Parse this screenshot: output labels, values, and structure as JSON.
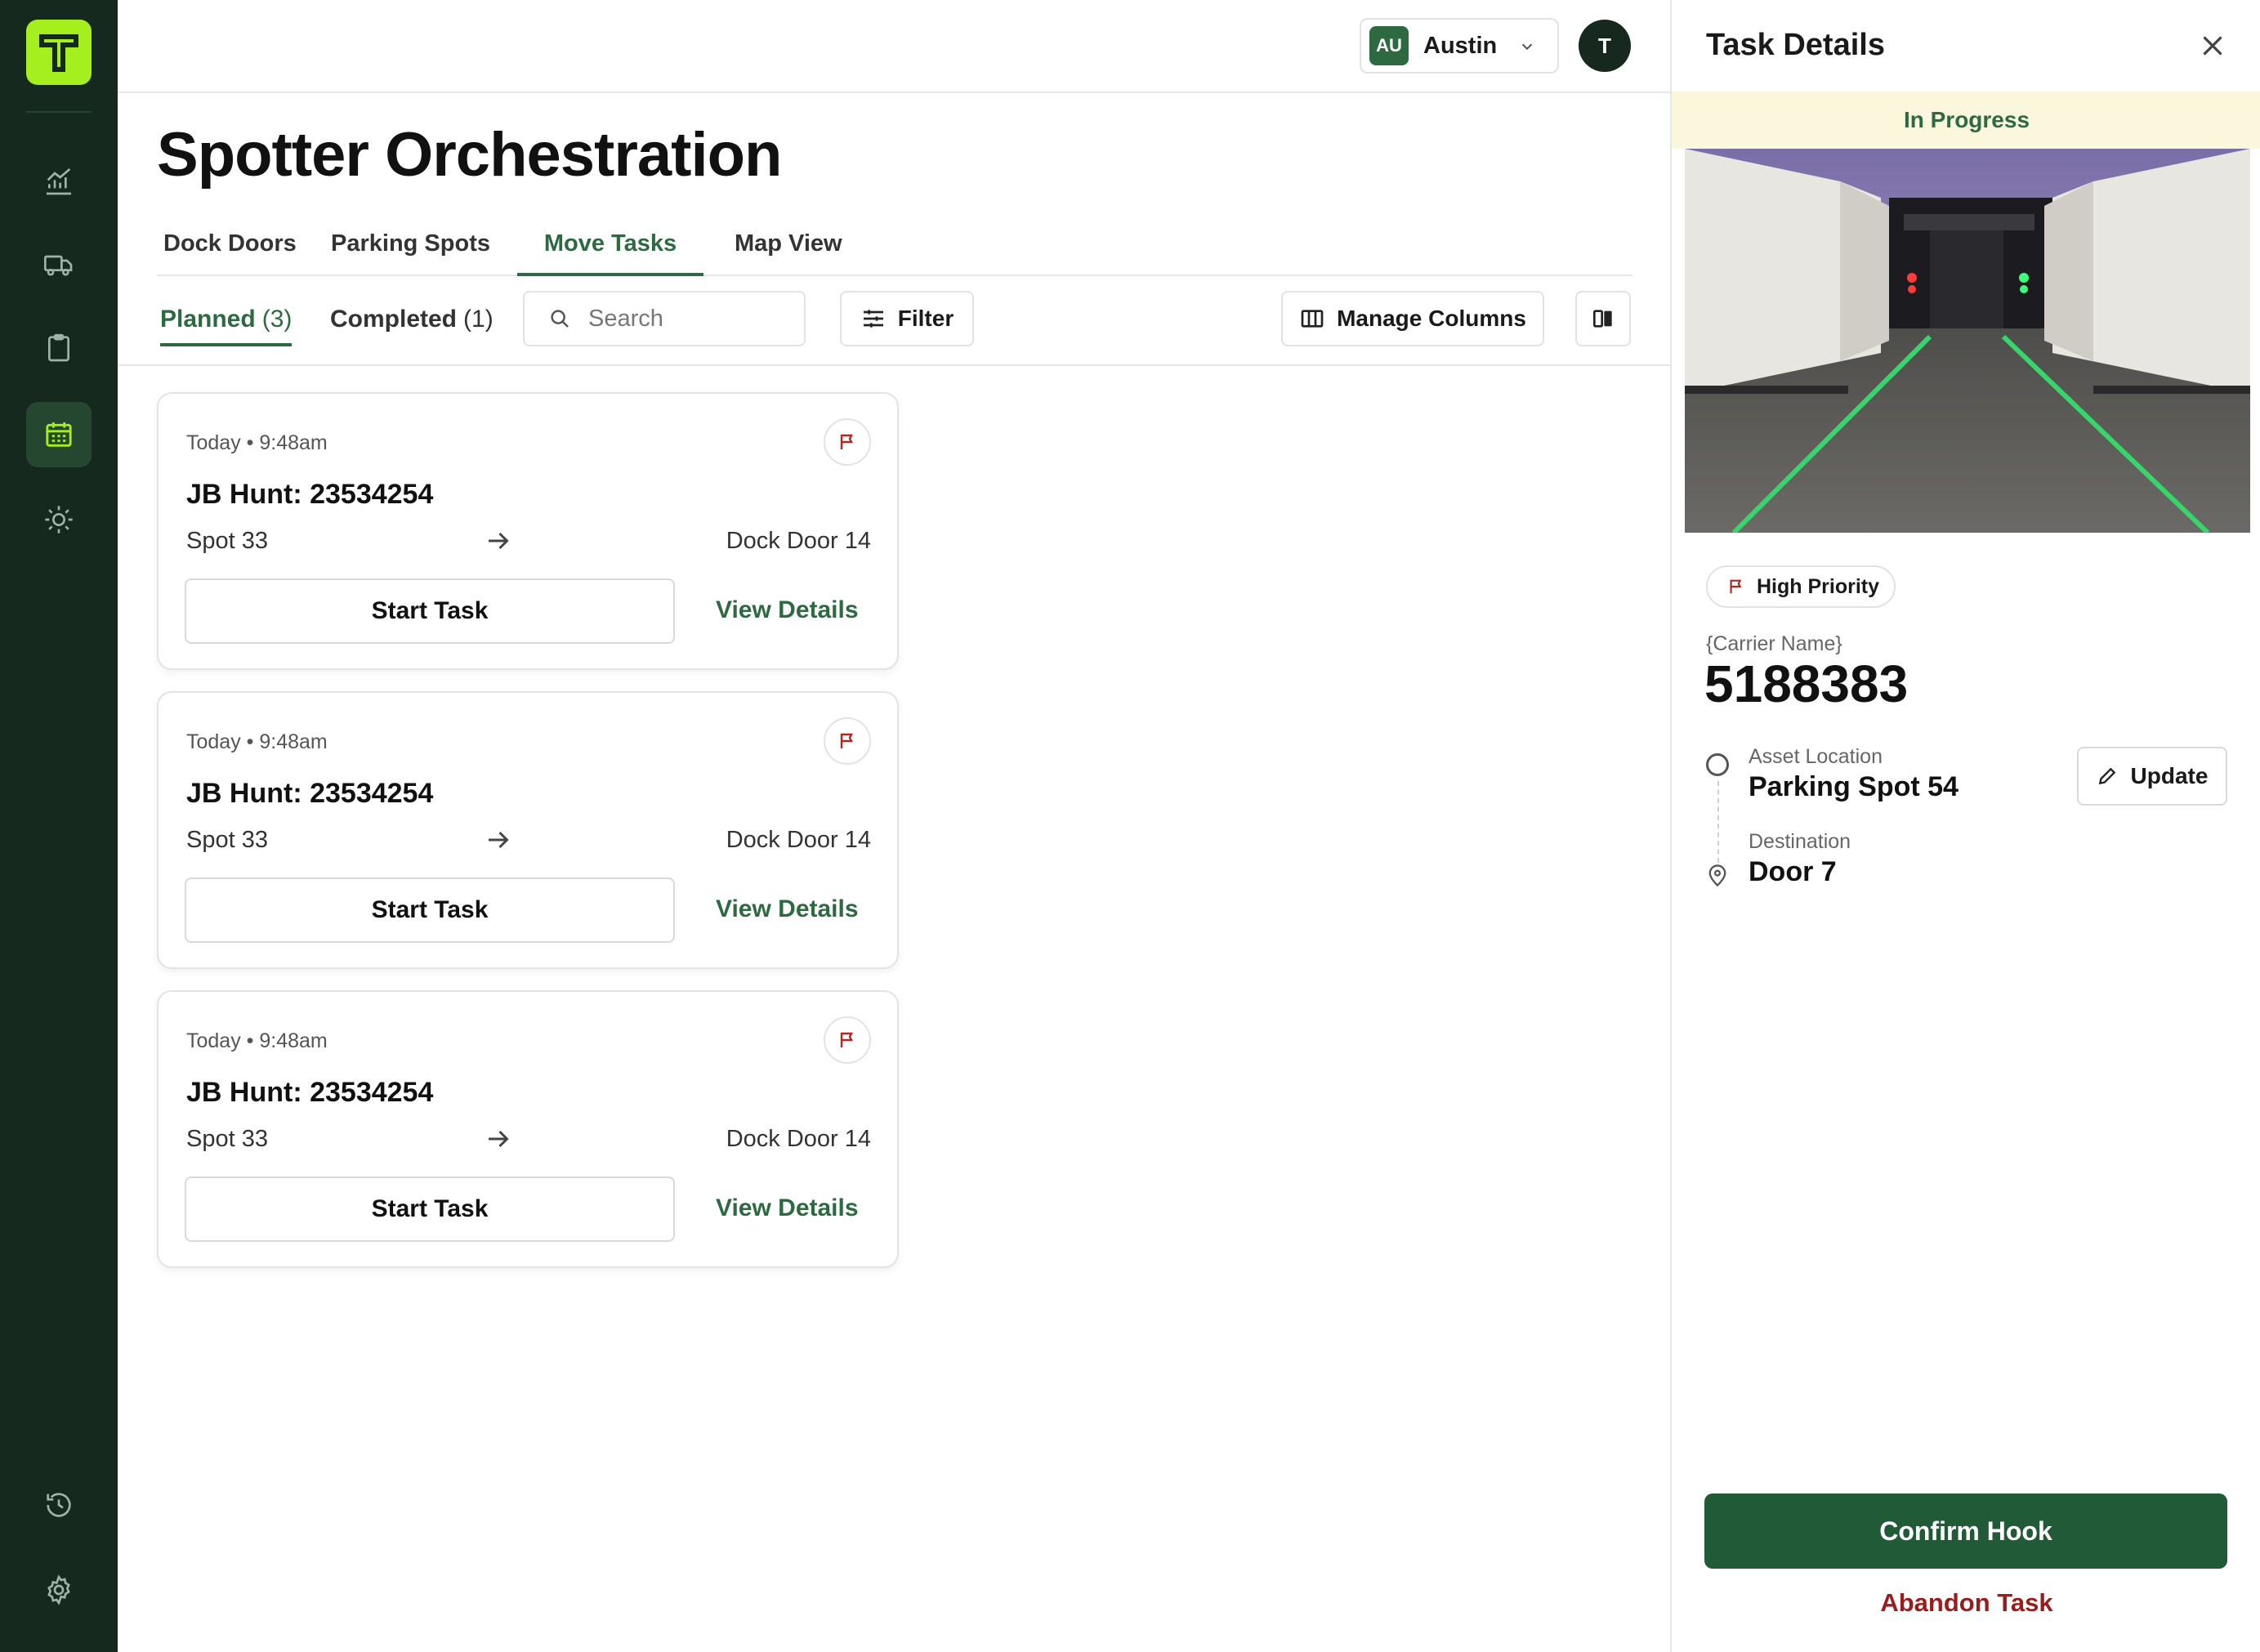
{
  "app": {
    "location_badge": "AU",
    "location_name": "Austin",
    "avatar_initial": "T"
  },
  "sidebar": {
    "items": [
      {
        "icon": "analytics-icon"
      },
      {
        "icon": "truck-icon"
      },
      {
        "icon": "clipboard-icon"
      },
      {
        "icon": "calendar-icon",
        "active": true
      },
      {
        "icon": "sun-icon"
      },
      {
        "icon": "history-icon"
      },
      {
        "icon": "settings-icon"
      }
    ]
  },
  "page": {
    "title": "Spotter Orchestration",
    "tabs": [
      "Dock Doors",
      "Parking Spots",
      "Move Tasks",
      "Map View"
    ],
    "active_tab": "Move Tasks"
  },
  "subtabs": {
    "planned_label": "Planned",
    "planned_count": "(3)",
    "completed_label": "Completed",
    "completed_count": "(1)"
  },
  "toolbar": {
    "search_placeholder": "Search",
    "filter_label": "Filter",
    "manage_columns_label": "Manage Columns"
  },
  "tasks": [
    {
      "time": "Today • 9:48am",
      "carrier": "JB Hunt: 23534254",
      "from": "Spot 33",
      "to": "Dock Door 14",
      "start_label": "Start Task",
      "details_label": "View Details"
    },
    {
      "time": "Today • 9:48am",
      "carrier": "JB Hunt: 23534254",
      "from": "Spot 33",
      "to": "Dock Door 14",
      "start_label": "Start Task",
      "details_label": "View Details"
    },
    {
      "time": "Today • 9:48am",
      "carrier": "JB Hunt: 23534254",
      "from": "Spot 33",
      "to": "Dock Door 14",
      "start_label": "Start Task",
      "details_label": "View Details"
    }
  ],
  "details": {
    "title": "Task Details",
    "status": "In Progress",
    "priority": "High Priority",
    "carrier_label": "{Carrier Name}",
    "trailer_number": "5188383",
    "asset_location_label": "Asset Location",
    "asset_location_value": "Parking Spot 54",
    "update_label": "Update",
    "destination_label": "Destination",
    "destination_value": "Door 7",
    "confirm_label": "Confirm Hook",
    "abandon_label": "Abandon Task"
  },
  "colors": {
    "sidebar_bg": "#15291f",
    "logo_accent": "#a6ef1f",
    "primary_green": "#2d6a41",
    "confirm_green": "#215a36",
    "danger_red": "#9b1c1c",
    "status_strip": "#fbf7dd"
  }
}
